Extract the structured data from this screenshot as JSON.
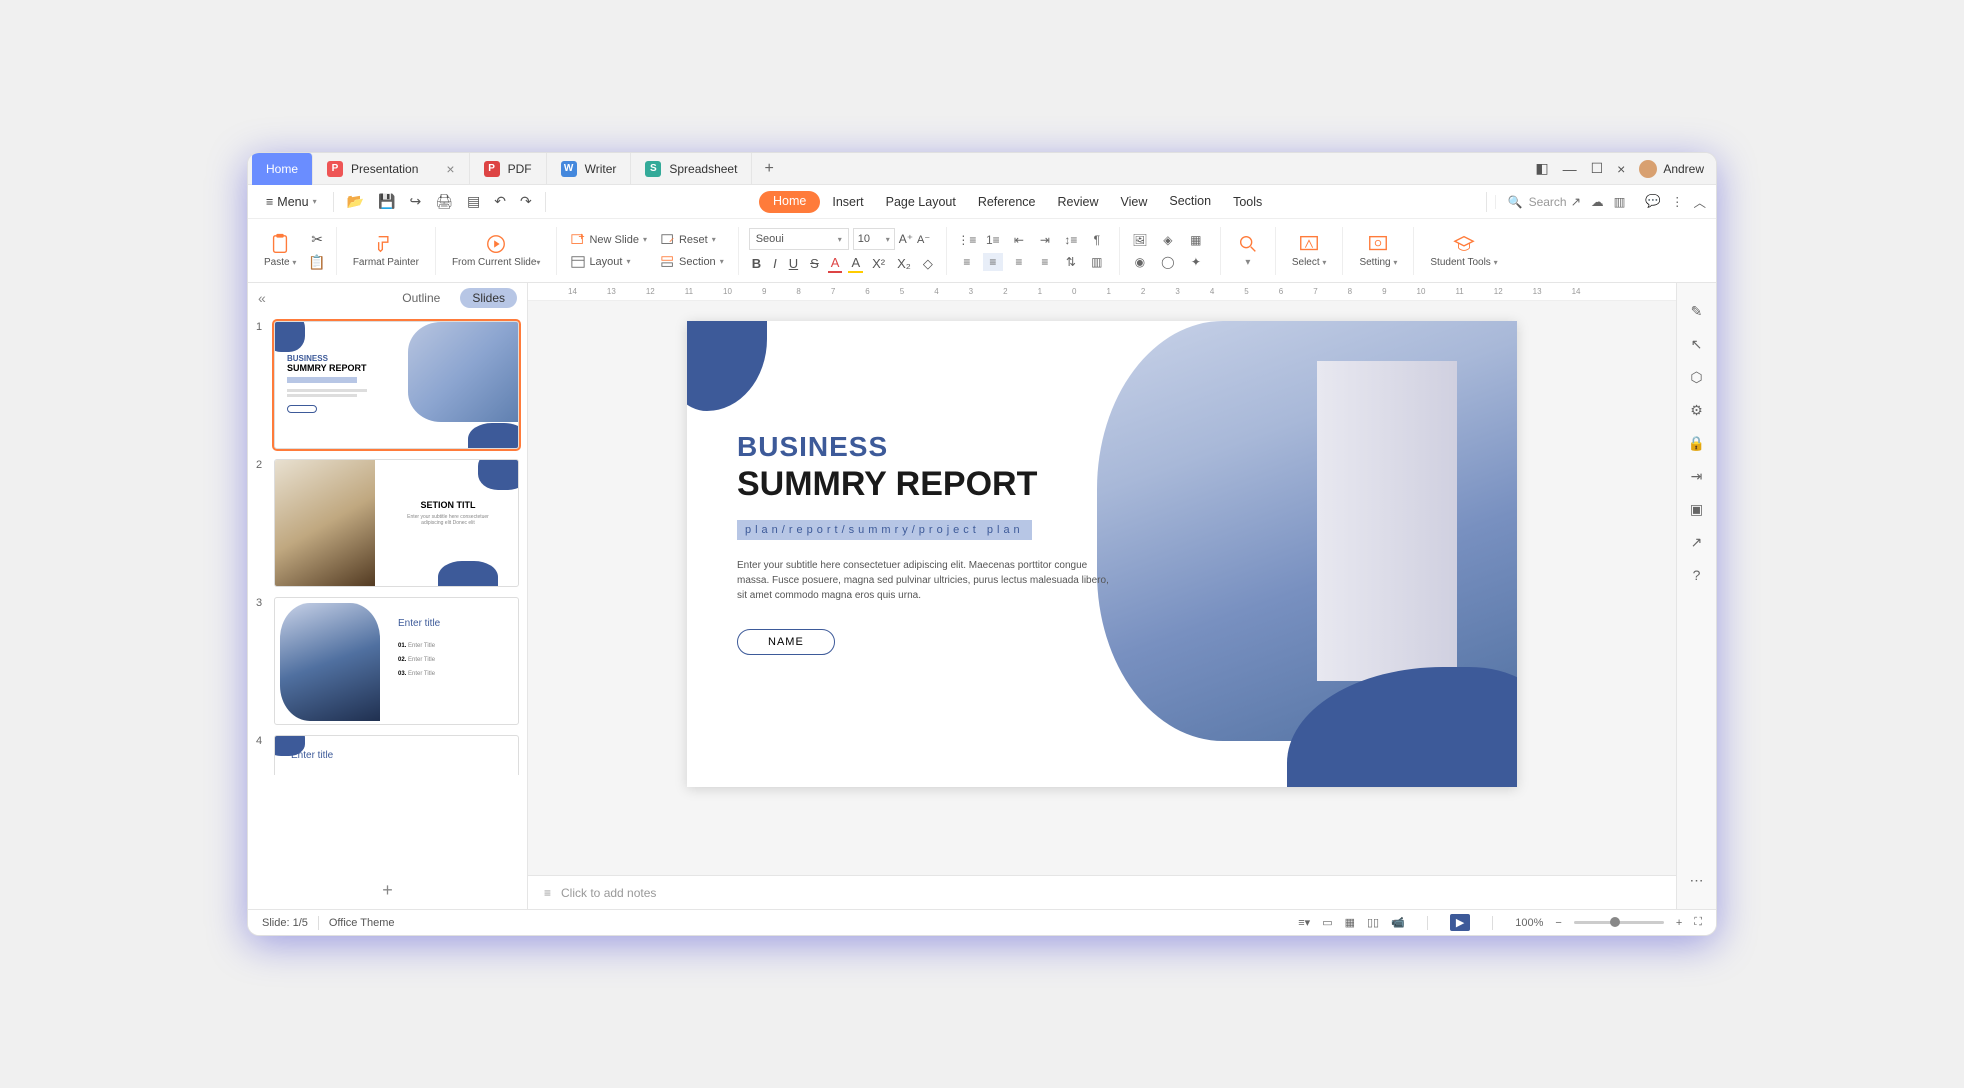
{
  "titlebar": {
    "home_tab": "Home",
    "tabs": [
      {
        "icon_bg": "#e55",
        "icon_letter": "P",
        "label": "Presentation",
        "closable": true
      },
      {
        "icon_bg": "#d44",
        "icon_letter": "P",
        "label": "PDF",
        "closable": false
      },
      {
        "icon_bg": "#4488dd",
        "icon_letter": "W",
        "label": "Writer",
        "closable": false
      },
      {
        "icon_bg": "#3a9",
        "icon_letter": "S",
        "label": "Spreadsheet",
        "closable": false
      }
    ],
    "user_name": "Andrew"
  },
  "menubar": {
    "menu_label": "Menu",
    "items": [
      "Home",
      "Insert",
      "Page Layout",
      "Reference",
      "Review",
      "View",
      "Section",
      "Tools"
    ],
    "search_placeholder": "Search"
  },
  "ribbon": {
    "paste": "Paste",
    "format_painter": "Farmat Painter",
    "from_current_slide": "From Current Slide",
    "new_slide": "New Slide",
    "layout": "Layout",
    "reset": "Reset",
    "section": "Section",
    "font_name": "Seoui",
    "font_size": "10",
    "select": "Select",
    "setting": "Setting",
    "student_tools": "Student Tools"
  },
  "left_panel": {
    "outline": "Outline",
    "slides": "Slides",
    "thumbs": [
      {
        "num": "1",
        "selected": true,
        "title1": "BUSINESS",
        "title2": "SUMMRY REPORT"
      },
      {
        "num": "2",
        "selected": false,
        "title1": "SETION TITL",
        "title2": "Enter your subtitle here consectetuer adipiscing elit Donec elit"
      },
      {
        "num": "3",
        "selected": false,
        "title1": "Enter title",
        "items": [
          "01.",
          "02.",
          "03."
        ],
        "item_label": "Enter Title"
      },
      {
        "num": "4",
        "selected": false,
        "title1": "Enter title"
      }
    ]
  },
  "slide": {
    "business": "BUSINESS",
    "summry": "SUMMRY REPORT",
    "path": "plan/report/summry/project plan",
    "subtitle": "Enter your subtitle here consectetuer adipiscing elit. Maecenas porttitor congue massa. Fusce posuere, magna sed pulvinar ultricies, purus lectus malesuada libero, sit amet commodo magna eros quis urna.",
    "name_button": "NAME"
  },
  "notes": {
    "placeholder": "Click to add notes"
  },
  "statusbar": {
    "slide_count": "Slide: 1/5",
    "theme": "Office Theme",
    "zoom": "100%"
  },
  "ruler_marks": [
    "14",
    "13",
    "12",
    "11",
    "10",
    "9",
    "8",
    "7",
    "6",
    "5",
    "4",
    "3",
    "2",
    "1",
    "0",
    "1",
    "2",
    "3",
    "4",
    "5",
    "6",
    "7",
    "8",
    "9",
    "10",
    "11",
    "12",
    "13",
    "14"
  ]
}
